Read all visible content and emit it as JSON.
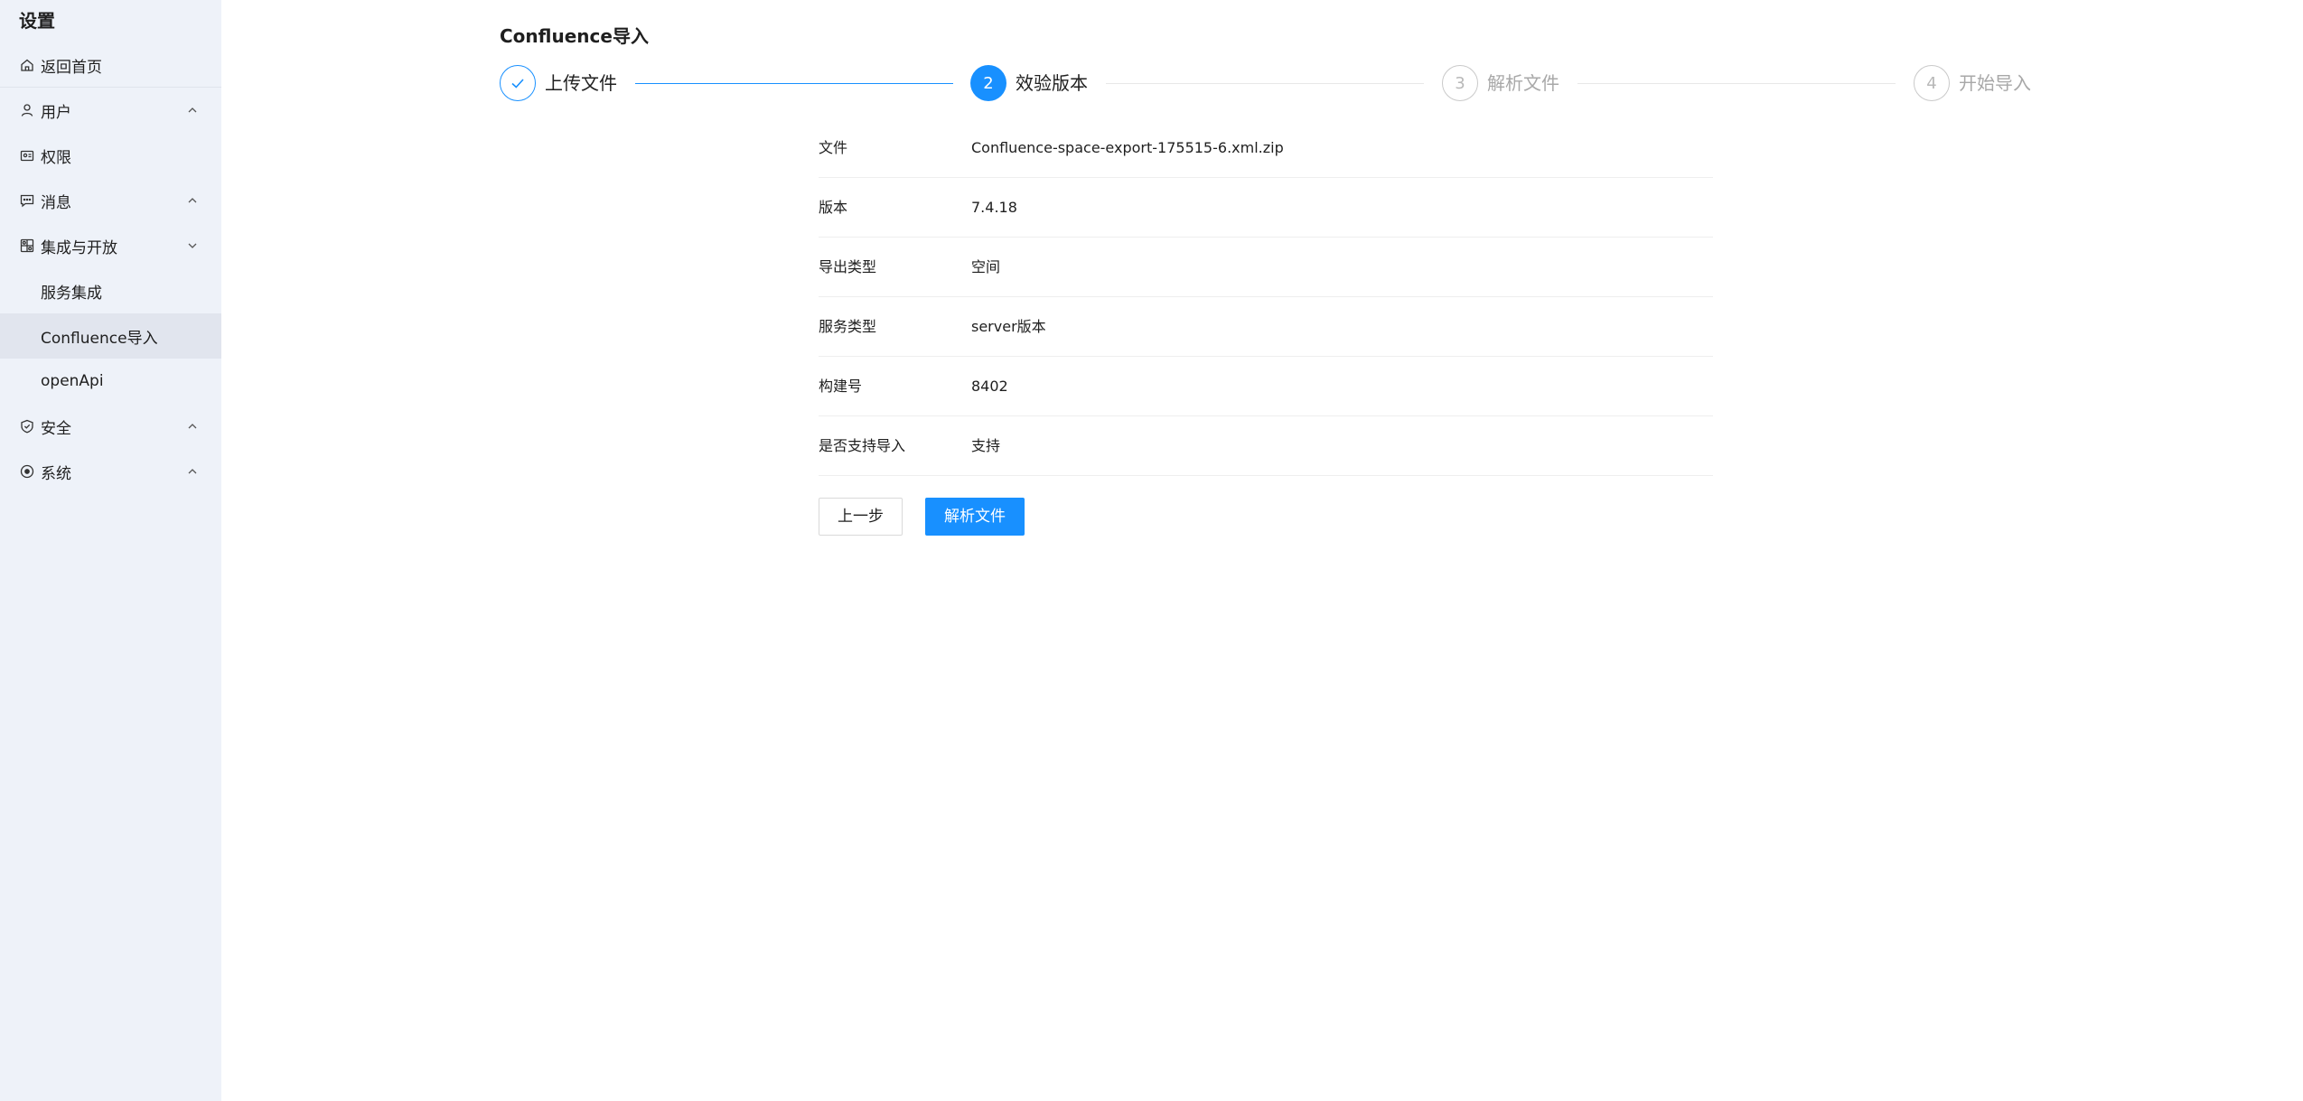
{
  "sidebar": {
    "title": "设置",
    "items": [
      {
        "label": "返回首页",
        "icon": "home-icon"
      },
      {
        "label": "用户",
        "icon": "user-icon",
        "chevron": "up"
      },
      {
        "label": "权限",
        "icon": "permission-icon"
      },
      {
        "label": "消息",
        "icon": "message-icon",
        "chevron": "up"
      },
      {
        "label": "集成与开放",
        "icon": "integration-icon",
        "chevron": "down"
      },
      {
        "label": "服务集成",
        "sub": true
      },
      {
        "label": "Confluence导入",
        "sub": true,
        "active": true
      },
      {
        "label": "openApi",
        "sub": true
      },
      {
        "label": "安全",
        "icon": "security-shield-icon",
        "chevron": "up"
      },
      {
        "label": "系统",
        "icon": "system-icon",
        "chevron": "up"
      }
    ]
  },
  "main": {
    "title": "Confluence导入",
    "steps": [
      {
        "label": "上传文件",
        "number": "",
        "status": "done"
      },
      {
        "label": "效验版本",
        "number": "2",
        "status": "current"
      },
      {
        "label": "解析文件",
        "number": "3",
        "status": "wait"
      },
      {
        "label": "开始导入",
        "number": "4",
        "status": "wait"
      }
    ],
    "info": [
      {
        "key": "文件",
        "value": "Confluence-space-export-175515-6.xml.zip"
      },
      {
        "key": "版本",
        "value": "7.4.18"
      },
      {
        "key": "导出类型",
        "value": "空间"
      },
      {
        "key": "服务类型",
        "value": "server版本"
      },
      {
        "key": "构建号",
        "value": "8402"
      },
      {
        "key": "是否支持导入",
        "value": "支持"
      }
    ],
    "buttons": {
      "prev": "上一步",
      "parse": "解析文件"
    }
  },
  "colors": {
    "primary": "#1890ff",
    "sidebar_bg": "#eef2f9",
    "sidebar_active": "#e1e5ee"
  }
}
